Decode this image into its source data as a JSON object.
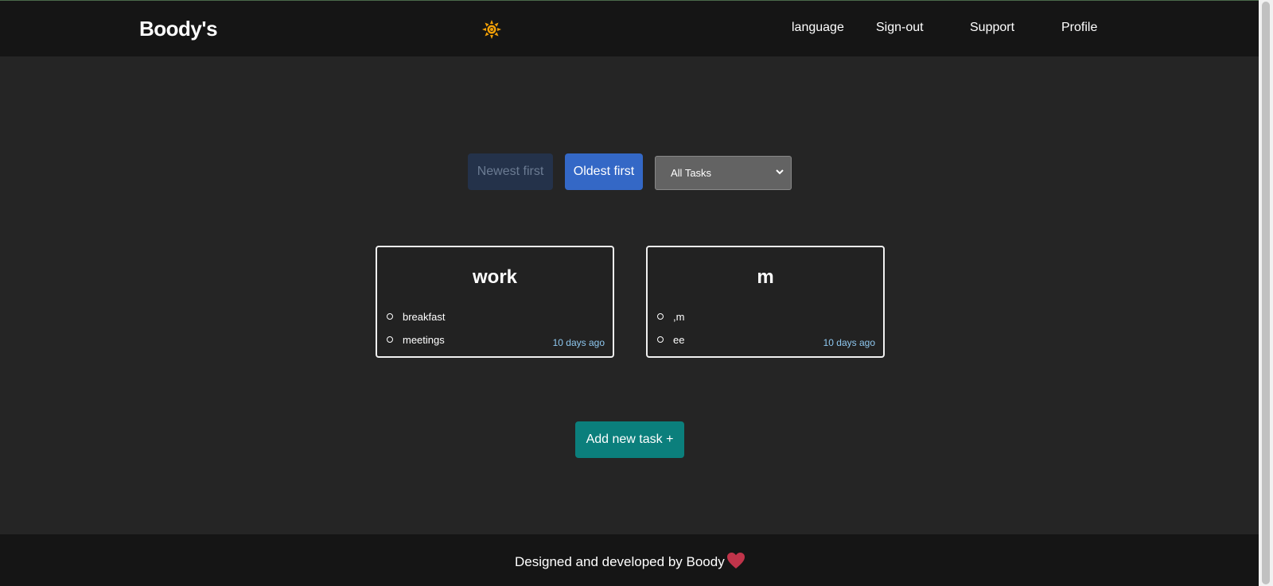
{
  "navbar": {
    "brand": "Boody's",
    "theme_icon": "sun-icon",
    "links": [
      {
        "label": "language"
      },
      {
        "label": "Sign-out"
      },
      {
        "label": "Support"
      },
      {
        "label": "Profile"
      }
    ]
  },
  "controls": {
    "newest_label": "Newest first",
    "oldest_label": "Oldest first",
    "filter_selected": "All Tasks"
  },
  "cards": [
    {
      "title": "work",
      "items": [
        "breakfast",
        "meetings"
      ],
      "time": "10 days ago"
    },
    {
      "title": "m",
      "items": [
        ",m",
        "ee"
      ],
      "time": "10 days ago"
    }
  ],
  "add_button": {
    "label": "Add new task +"
  },
  "footer": {
    "text": "Designed and developed by Boody",
    "icon": "heart-icon"
  },
  "colors": {
    "background": "#252525",
    "navbar": "#151515",
    "primary": "#3468c6",
    "primary_disabled": "#24324a",
    "add_button": "#0b7f7c",
    "heart": "#c0344a",
    "sun": "#f2a007",
    "timestamp": "#8ec8f0"
  }
}
